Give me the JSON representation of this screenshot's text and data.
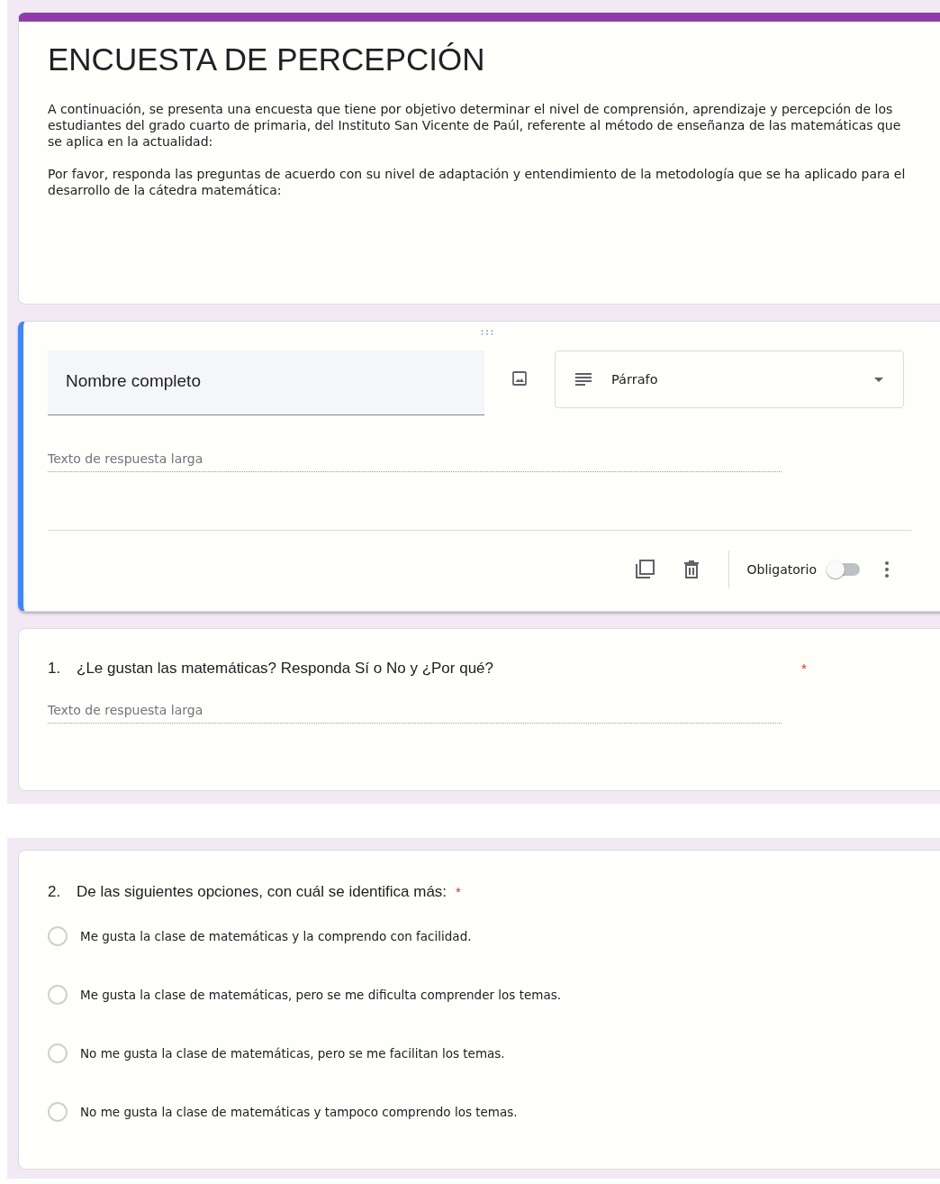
{
  "header": {
    "title": "ENCUESTA DE PERCEPCIÓN",
    "description": [
      "A continuación, se presenta una encuesta que tiene por objetivo determinar el nivel de comprensión, aprendizaje y percepción de los estudiantes del grado cuarto de primaria, del Instituto San Vicente de Paúl, referente al método de enseñanza de las matemáticas que se aplica en la actualidad:",
      "Por favor, responda las preguntas de acuerdo con su nivel de adaptación y entendimiento de la metodología que se ha aplicado para el desarrollo de la cátedra matemática:"
    ]
  },
  "editing_question": {
    "title": "Nombre completo",
    "type_label": "Párrafo",
    "answer_placeholder": "Texto de respuesta larga",
    "required_label": "Obligatorio",
    "required": false
  },
  "questions": [
    {
      "kind": "paragraph",
      "number": "1.",
      "text": "¿Le gustan las matemáticas? Responda Sí o No y ¿Por qué?",
      "required_mark": "*",
      "answer_placeholder": "Texto de respuesta larga"
    },
    {
      "kind": "choice",
      "number": "2.",
      "text": "De las siguientes opciones, con cuál se identifica más:",
      "required_mark": "*",
      "options": [
        {
          "label": "Me gusta la clase de matemáticas y la comprendo con facilidad.",
          "selected": false
        },
        {
          "label": "Me gusta la clase de matemáticas, pero se me dificulta comprender los temas.",
          "selected": false
        },
        {
          "label": "No me gusta la clase de matemáticas, pero se me facilitan los temas.",
          "selected": false
        },
        {
          "label": "No me gusta la clase de matemáticas y tampoco comprendo los temas.",
          "selected": false
        }
      ]
    }
  ]
}
